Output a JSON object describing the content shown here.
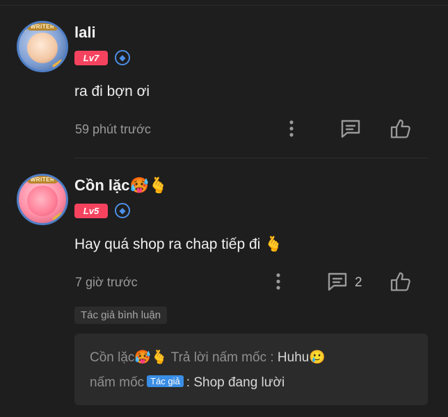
{
  "comments": [
    {
      "username": "lali",
      "level": "Lv7",
      "text": "ra đi bợn ơi",
      "time": "59 phút trước",
      "avatar_banner": "WRITER"
    },
    {
      "username": "Cồn lặc🥵🫰",
      "level": "Lv5",
      "text": "Hay quá shop ra chap tiếp đi 🫰",
      "time": "7 giờ trước",
      "reply_count": "2",
      "avatar_banner": "WRITER",
      "author_badge": "Tác giả bình luận",
      "reply": {
        "from": "Cồn lặc🥵🫰",
        "action": "Trả lời nấm mốc :",
        "reply_text": "Huhu🥲",
        "author_name": "nấm mốc",
        "author_tag": "Tác giả",
        "author_text": ": Shop đang lười"
      }
    }
  ],
  "colors": {
    "background": "#1e1e1e",
    "level_badge": "#f5435f",
    "eth_badge": "#4d8fe9",
    "author_tag": "#3a8ee6"
  },
  "icons": [
    "ethereum-icon",
    "more-vertical-icon",
    "comment-icon",
    "thumbs-up-icon"
  ]
}
